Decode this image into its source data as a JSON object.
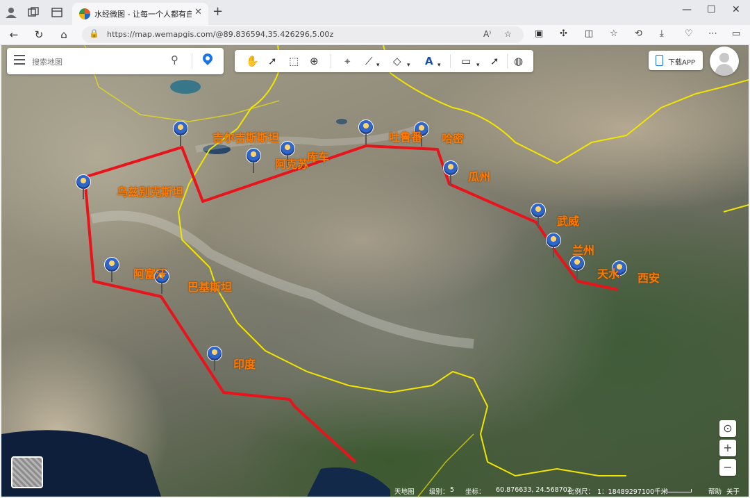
{
  "browser": {
    "tab_title": "水经微图 - 让每一个人都有自己",
    "url": "https://map.wemapgis.com/@89.836594,35.426296,5.00z"
  },
  "map": {
    "search_placeholder": "搜索地图",
    "download_app_label": "下载APP",
    "labels": [
      {
        "id": "jierjisi",
        "text": "吉尔吉斯斯坦"
      },
      {
        "id": "tulufan",
        "text": "吐鲁番"
      },
      {
        "id": "hami",
        "text": "哈密"
      },
      {
        "id": "akesu",
        "text": "阿克苏"
      },
      {
        "id": "kuche",
        "text": "库车"
      },
      {
        "id": "guazhou",
        "text": "瓜州"
      },
      {
        "id": "wuzibieke",
        "text": "乌兹别克斯坦"
      },
      {
        "id": "wuwei",
        "text": "武威"
      },
      {
        "id": "lanzhou",
        "text": "兰州"
      },
      {
        "id": "tianshui",
        "text": "天水"
      },
      {
        "id": "xian",
        "text": "西安"
      },
      {
        "id": "afuhan",
        "text": "阿富汗"
      },
      {
        "id": "bajisitan",
        "text": "巴基斯坦"
      },
      {
        "id": "yindu",
        "text": "印度"
      }
    ],
    "status": {
      "basemap": "天地图",
      "level_label": "级别：",
      "level": "5",
      "coord_label": "坐标：",
      "coord": "60.876633, 24.568702",
      "scale_label": "比例尺：",
      "scale": "1：18489297",
      "scale_bar": "100千米",
      "help": "帮助",
      "about": "关于"
    },
    "colors": {
      "route": "#e8141c",
      "border": "#f2e600",
      "label": "#ff7a00"
    }
  }
}
